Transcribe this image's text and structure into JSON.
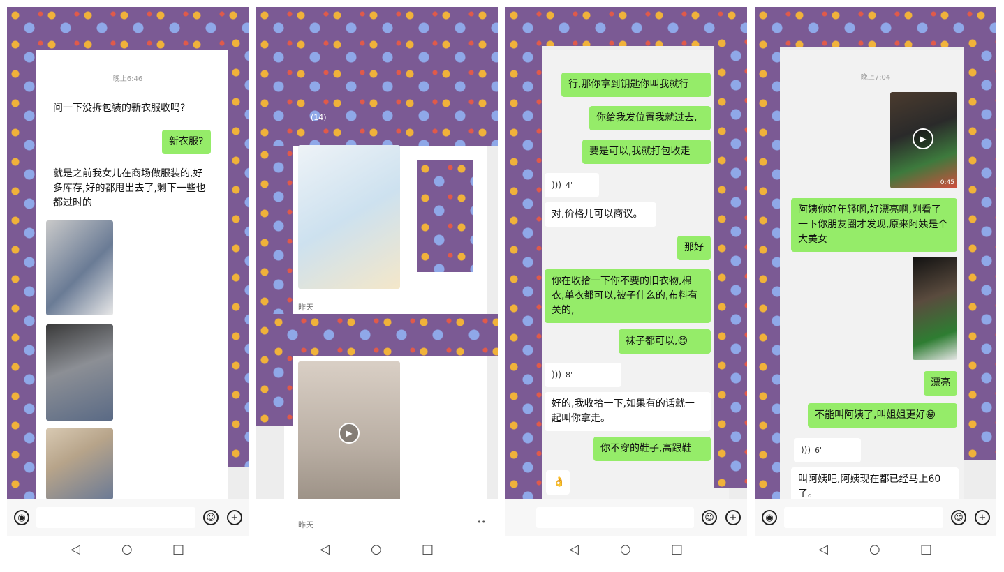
{
  "panel1": {
    "time": "晚上6:46",
    "msg1": "问一下没拆包装的新衣服收吗?",
    "msg2": "新衣服?",
    "msg3": "就是之前我女儿在商场做服装的,好多库存,好的都甩出去了,剩下一些也都过时的"
  },
  "panel2": {
    "count": "(14)",
    "date1": "昨天",
    "date2": "昨天",
    "dots": "••"
  },
  "panel3": {
    "msg1": "行,那你拿到钥匙你叫我就行",
    "msg2": "你给我发位置我就过去,",
    "msg3": "要是可以,我就打包收走",
    "voice1": "4\"",
    "msg4": "对,价格儿可以商议。",
    "msg5": "那好",
    "msg6": "你在收拾一下你不要的旧衣物,棉衣,单衣都可以,被子什么的,布料有关的,",
    "msg7": "袜子都可以,😊",
    "voice2": "8\"",
    "msg8": "好的,我收拾一下,如果有的话就一起叫你拿走。",
    "msg9": "你不穿的鞋子,高跟鞋",
    "emoji": "👌"
  },
  "panel4": {
    "time": "晚上7:04",
    "duration": "0:45",
    "msg1": "阿姨你好年轻啊,好漂亮啊,刚看了一下你朋友圈才发现,原来阿姨是个大美女",
    "msg2": "漂亮",
    "msg3": "不能叫阿姨了,叫姐姐更好😁",
    "voice": "6\"",
    "msg4": "叫阿姨吧,阿姨现在都已经马上60了。"
  },
  "icons": {
    "voice": "voice-icon",
    "emoji": "emoji-icon",
    "plus": "plus-icon",
    "back": "back-icon",
    "home": "home-icon",
    "recent": "recent-icon"
  },
  "colors": {
    "outgoing": "#95ec69",
    "incoming": "#ffffff",
    "pattern": "#7b5a94"
  }
}
